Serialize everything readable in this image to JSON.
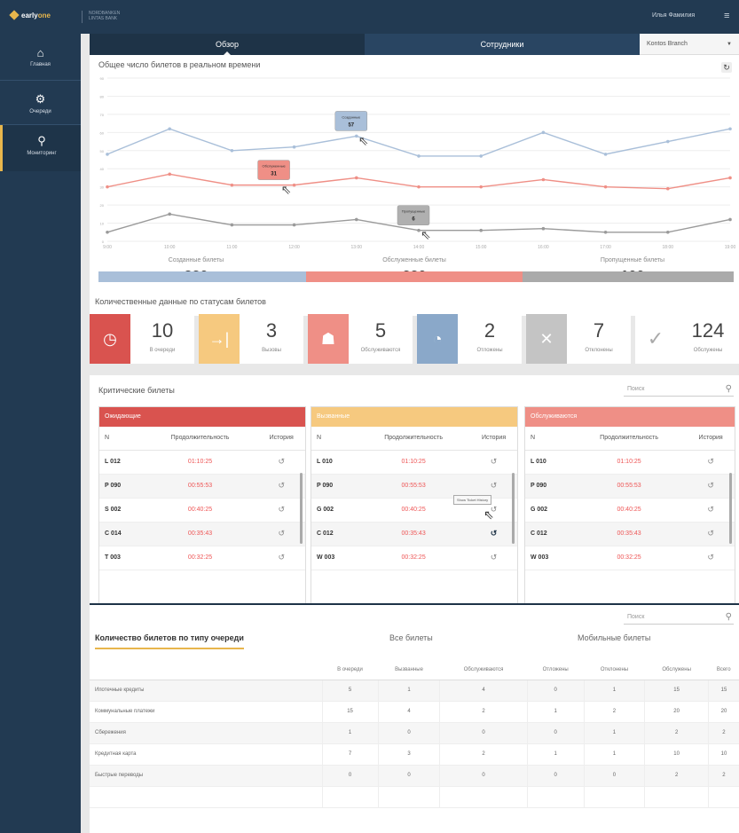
{
  "topbar": {
    "logo_a": "early",
    "logo_b": "one",
    "company": "NORDBANKEN LINTAS BANK",
    "user": "Илья Фамилия"
  },
  "sidebar": {
    "items": [
      {
        "label": "Главная",
        "icon": "home-icon"
      },
      {
        "label": "Очереди",
        "icon": "queue-icon"
      },
      {
        "label": "Мониторинг",
        "icon": "monitor-icon"
      }
    ]
  },
  "tabs": {
    "overview": "Обзор",
    "employees": "Сотрудники",
    "branch": "Kontos Branch"
  },
  "realtime": {
    "title": "Общее число билетов в реальном времени"
  },
  "chart_data": {
    "type": "line",
    "title": "Общее число билетов в реальном времени",
    "x": [
      "9:00",
      "10:00",
      "11:00",
      "12:00",
      "13:00",
      "14:00",
      "15:00",
      "16:00",
      "17:00",
      "18:00",
      "19:00"
    ],
    "ylim": [
      0,
      90
    ],
    "yticks": [
      0,
      10,
      20,
      30,
      40,
      50,
      60,
      70,
      80,
      90
    ],
    "series": [
      {
        "name": "Созданные",
        "color": "#a9bfd9",
        "values": [
          48,
          62,
          50,
          52,
          58,
          47,
          47,
          60,
          48,
          55,
          62
        ]
      },
      {
        "name": "Обслуженные",
        "color": "#ef8f86",
        "values": [
          30,
          37,
          31,
          31,
          35,
          30,
          30,
          34,
          30,
          29,
          35
        ]
      },
      {
        "name": "Пропущенные",
        "color": "#9a9a9a",
        "values": [
          5,
          15,
          9,
          9,
          12,
          6,
          6,
          7,
          5,
          5,
          12
        ]
      }
    ],
    "tooltips": [
      {
        "series": "Созданные",
        "label": "Созданные",
        "value": "57"
      },
      {
        "series": "Обслуженные",
        "label": "Обслуженные",
        "value": "31"
      },
      {
        "series": "Пропущенные",
        "label": "Пропущенные",
        "value": "6"
      }
    ]
  },
  "totals": [
    {
      "label": "Созданные билеты",
      "value": "320",
      "color": "#a9bfd9"
    },
    {
      "label": "Обслуженные билеты",
      "value": "220",
      "color": "#ef8f86"
    },
    {
      "label": "Пропущенные билеты",
      "value": "100",
      "color": "#aaaaaa"
    }
  ],
  "status_section": {
    "title": "Количественные данные по статусам билетов"
  },
  "kpis": [
    {
      "num": "10",
      "cap": "В очереди",
      "color": "#d9534f",
      "icon": "clock-icon"
    },
    {
      "num": "3",
      "cap": "Вызовы",
      "color": "#f6c97f",
      "icon": "call-arrow-icon"
    },
    {
      "num": "5",
      "cap": "Обслуживаются",
      "color": "#ef8f86",
      "icon": "service-icon"
    },
    {
      "num": "2",
      "cap": "Отложены",
      "color": "#8aa8c9",
      "icon": "postpone-icon"
    },
    {
      "num": "7",
      "cap": "Отклонены",
      "color": "#c4c4c4",
      "icon": "cross-icon"
    },
    {
      "num": "124",
      "cap": "Обслужены",
      "color": "#ffffff",
      "icon": "check-icon"
    }
  ],
  "critical": {
    "title": "Критические билеты",
    "search": "Поиск",
    "columns": [
      "N",
      "Продолжительность",
      "История"
    ],
    "tables": [
      {
        "title": "Ожидающие",
        "color": "#d9534f",
        "rows": [
          [
            "L 012",
            "01:10:25"
          ],
          [
            "P 090",
            "00:55:53"
          ],
          [
            "S 002",
            "00:40:25"
          ],
          [
            "C 014",
            "00:35:43"
          ],
          [
            "T 003",
            "00:32:25"
          ]
        ]
      },
      {
        "title": "Вызванные",
        "color": "#f6c97f",
        "rows": [
          [
            "L 010",
            "01:10:25"
          ],
          [
            "P 090",
            "00:55:53"
          ],
          [
            "G 002",
            "00:40:25"
          ],
          [
            "C 012",
            "00:35:43"
          ],
          [
            "W 003",
            "00:32:25"
          ]
        ]
      },
      {
        "title": "Обслуживаются",
        "color": "#ef8f86",
        "rows": [
          [
            "L 010",
            "01:10:25"
          ],
          [
            "P 090",
            "00:55:53"
          ],
          [
            "G 002",
            "00:40:25"
          ],
          [
            "C 012",
            "00:35:43"
          ],
          [
            "W 003",
            "00:32:25"
          ]
        ]
      }
    ],
    "tooltip": "Show Ticket History"
  },
  "by_queue": {
    "title": "Количество билетов по типу очереди",
    "tab_all": "Все билеты",
    "tab_mobile": "Мобильные билеты",
    "search": "Поиск",
    "columns": [
      "",
      "В очереди",
      "Вызванные",
      "Обслуживаются",
      "Отложены",
      "Отклонены",
      "Обслужены",
      "Всего"
    ],
    "rows": [
      [
        "Ипотечные кредиты",
        "5",
        "1",
        "4",
        "0",
        "1",
        "15",
        "15"
      ],
      [
        "Коммунальные платежи",
        "15",
        "4",
        "2",
        "1",
        "2",
        "20",
        "20"
      ],
      [
        "Сбережения",
        "1",
        "0",
        "0",
        "0",
        "1",
        "2",
        "2"
      ],
      [
        "Кредитная карта",
        "7",
        "3",
        "2",
        "1",
        "1",
        "10",
        "10"
      ],
      [
        "Быстрые переводы",
        "0",
        "0",
        "0",
        "0",
        "0",
        "2",
        "2"
      ]
    ]
  }
}
